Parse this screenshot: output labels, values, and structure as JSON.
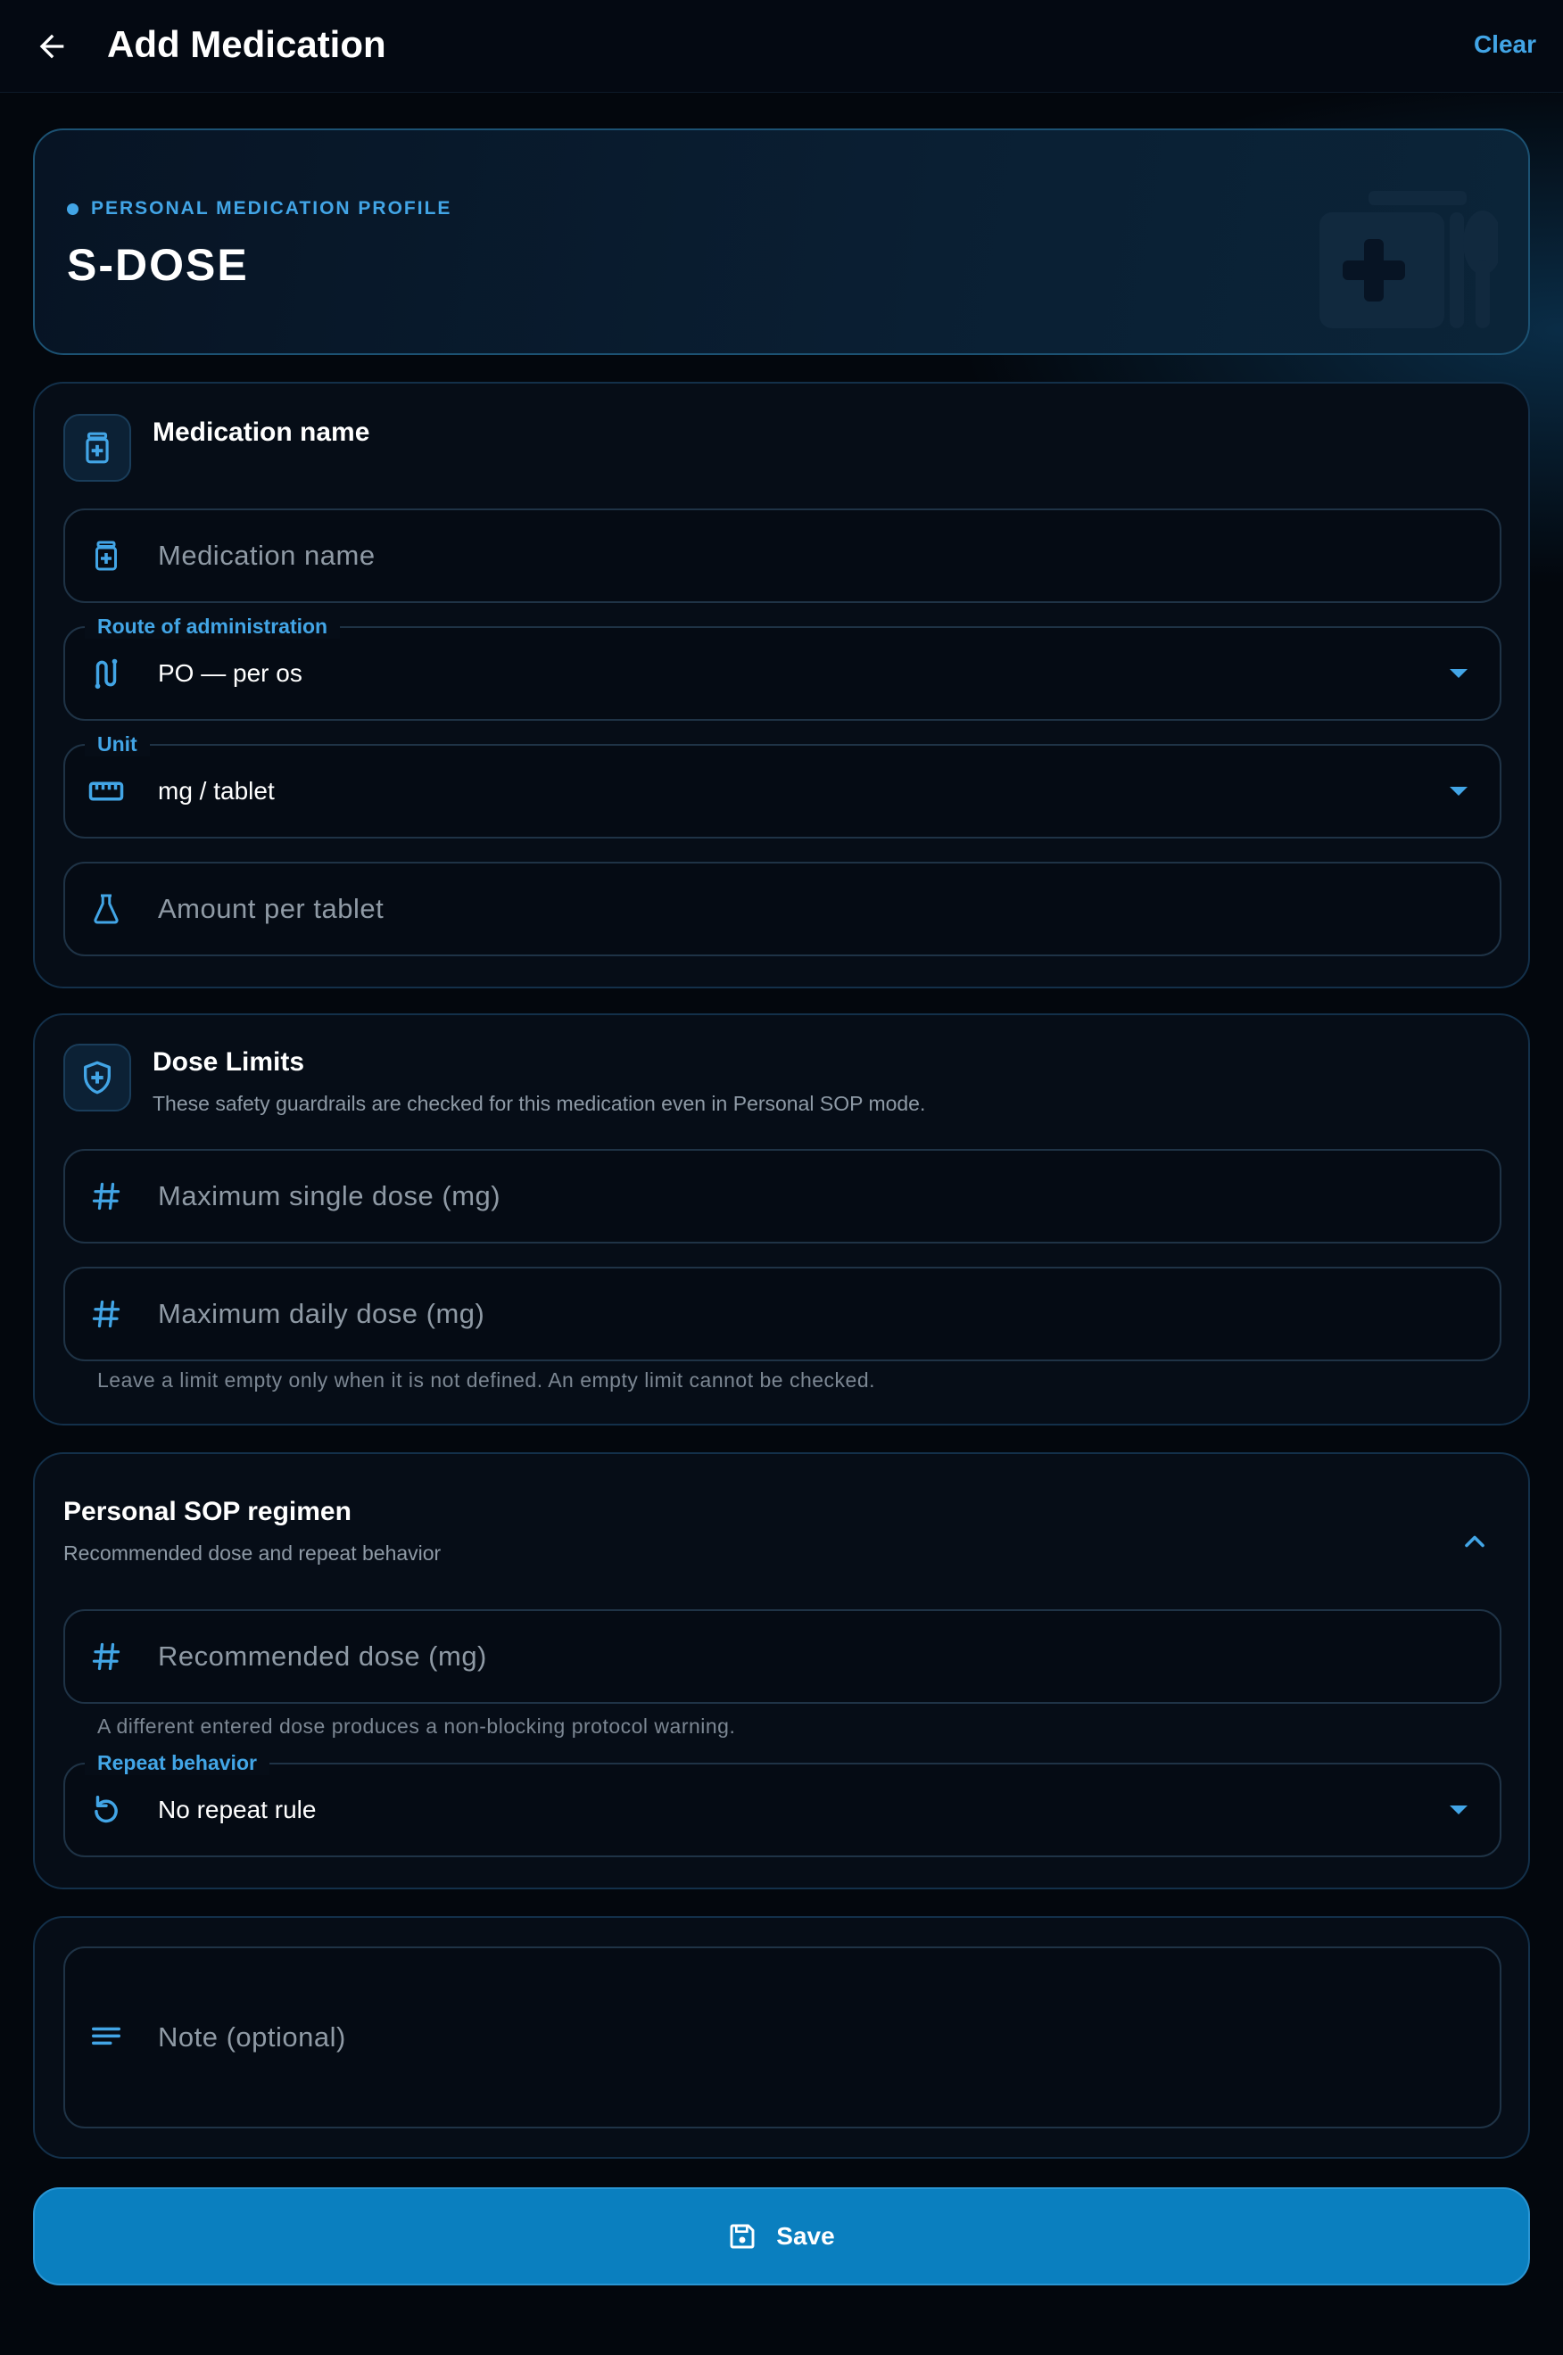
{
  "appbar": {
    "title": "Add Medication",
    "clear_label": "Clear"
  },
  "hero": {
    "kicker": "PERSONAL MEDICATION PROFILE",
    "title": "S-DOSE"
  },
  "medication": {
    "title": "Medication name",
    "name_placeholder": "Medication name",
    "route_label": "Route of administration",
    "route_value": "PO — per os",
    "unit_label": "Unit",
    "unit_value": "mg / tablet",
    "amount_placeholder": "Amount per tablet"
  },
  "limits": {
    "title": "Dose Limits",
    "subtitle": "These safety guardrails are checked for this medication even in Personal SOP mode.",
    "max_single_placeholder": "Maximum single dose (mg)",
    "max_daily_placeholder": "Maximum daily dose (mg)",
    "helper": "Leave a limit empty only when it is not defined. An empty limit cannot be checked."
  },
  "regimen": {
    "title": "Personal SOP regimen",
    "subtitle": "Recommended dose and repeat behavior",
    "dose_placeholder": "Recommended dose (mg)",
    "dose_helper": "A different entered dose produces a non-blocking protocol warning.",
    "repeat_label": "Repeat behavior",
    "repeat_value": "No repeat rule"
  },
  "note": {
    "placeholder": "Note (optional)"
  },
  "save": {
    "label": "Save"
  },
  "colors": {
    "accent": "#42a5e6",
    "primary_button": "#0a7fbf",
    "background": "#03070d"
  },
  "icons": [
    "arrow-left-icon",
    "medical-kit-icon",
    "pill-bottle-icon",
    "route-icon",
    "ruler-icon",
    "flask-icon",
    "shield-plus-icon",
    "hash-icon",
    "chevron-up-icon",
    "repeat-icon",
    "notes-icon",
    "floppy-disk-icon"
  ]
}
